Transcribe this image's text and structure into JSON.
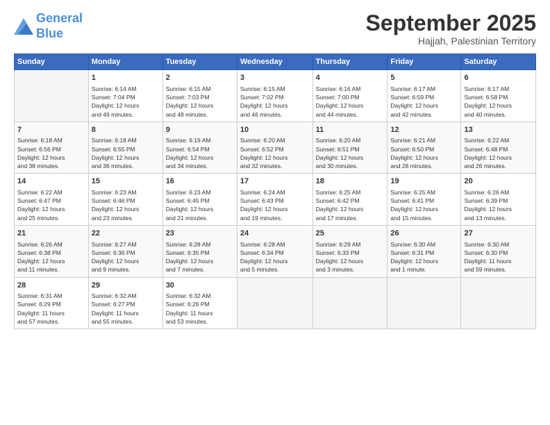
{
  "header": {
    "logo_line1": "General",
    "logo_line2": "Blue",
    "month": "September 2025",
    "location": "Hajjah, Palestinian Territory"
  },
  "days_of_week": [
    "Sunday",
    "Monday",
    "Tuesday",
    "Wednesday",
    "Thursday",
    "Friday",
    "Saturday"
  ],
  "weeks": [
    [
      {
        "day": "",
        "content": ""
      },
      {
        "day": "1",
        "content": "Sunrise: 6:14 AM\nSunset: 7:04 PM\nDaylight: 12 hours\nand 49 minutes."
      },
      {
        "day": "2",
        "content": "Sunrise: 6:15 AM\nSunset: 7:03 PM\nDaylight: 12 hours\nand 48 minutes."
      },
      {
        "day": "3",
        "content": "Sunrise: 6:15 AM\nSunset: 7:02 PM\nDaylight: 12 hours\nand 46 minutes."
      },
      {
        "day": "4",
        "content": "Sunrise: 6:16 AM\nSunset: 7:00 PM\nDaylight: 12 hours\nand 44 minutes."
      },
      {
        "day": "5",
        "content": "Sunrise: 6:17 AM\nSunset: 6:59 PM\nDaylight: 12 hours\nand 42 minutes."
      },
      {
        "day": "6",
        "content": "Sunrise: 6:17 AM\nSunset: 6:58 PM\nDaylight: 12 hours\nand 40 minutes."
      }
    ],
    [
      {
        "day": "7",
        "content": "Sunrise: 6:18 AM\nSunset: 6:56 PM\nDaylight: 12 hours\nand 38 minutes."
      },
      {
        "day": "8",
        "content": "Sunrise: 6:18 AM\nSunset: 6:55 PM\nDaylight: 12 hours\nand 36 minutes."
      },
      {
        "day": "9",
        "content": "Sunrise: 6:19 AM\nSunset: 6:54 PM\nDaylight: 12 hours\nand 34 minutes."
      },
      {
        "day": "10",
        "content": "Sunrise: 6:20 AM\nSunset: 6:52 PM\nDaylight: 12 hours\nand 32 minutes."
      },
      {
        "day": "11",
        "content": "Sunrise: 6:20 AM\nSunset: 6:51 PM\nDaylight: 12 hours\nand 30 minutes."
      },
      {
        "day": "12",
        "content": "Sunrise: 6:21 AM\nSunset: 6:50 PM\nDaylight: 12 hours\nand 28 minutes."
      },
      {
        "day": "13",
        "content": "Sunrise: 6:22 AM\nSunset: 6:48 PM\nDaylight: 12 hours\nand 26 minutes."
      }
    ],
    [
      {
        "day": "14",
        "content": "Sunrise: 6:22 AM\nSunset: 6:47 PM\nDaylight: 12 hours\nand 25 minutes."
      },
      {
        "day": "15",
        "content": "Sunrise: 6:23 AM\nSunset: 6:46 PM\nDaylight: 12 hours\nand 23 minutes."
      },
      {
        "day": "16",
        "content": "Sunrise: 6:23 AM\nSunset: 6:45 PM\nDaylight: 12 hours\nand 21 minutes."
      },
      {
        "day": "17",
        "content": "Sunrise: 6:24 AM\nSunset: 6:43 PM\nDaylight: 12 hours\nand 19 minutes."
      },
      {
        "day": "18",
        "content": "Sunrise: 6:25 AM\nSunset: 6:42 PM\nDaylight: 12 hours\nand 17 minutes."
      },
      {
        "day": "19",
        "content": "Sunrise: 6:25 AM\nSunset: 6:41 PM\nDaylight: 12 hours\nand 15 minutes."
      },
      {
        "day": "20",
        "content": "Sunrise: 6:26 AM\nSunset: 6:39 PM\nDaylight: 12 hours\nand 13 minutes."
      }
    ],
    [
      {
        "day": "21",
        "content": "Sunrise: 6:26 AM\nSunset: 6:38 PM\nDaylight: 12 hours\nand 11 minutes."
      },
      {
        "day": "22",
        "content": "Sunrise: 6:27 AM\nSunset: 6:36 PM\nDaylight: 12 hours\nand 9 minutes."
      },
      {
        "day": "23",
        "content": "Sunrise: 6:28 AM\nSunset: 6:35 PM\nDaylight: 12 hours\nand 7 minutes."
      },
      {
        "day": "24",
        "content": "Sunrise: 6:28 AM\nSunset: 6:34 PM\nDaylight: 12 hours\nand 5 minutes."
      },
      {
        "day": "25",
        "content": "Sunrise: 6:29 AM\nSunset: 6:33 PM\nDaylight: 12 hours\nand 3 minutes."
      },
      {
        "day": "26",
        "content": "Sunrise: 6:30 AM\nSunset: 6:31 PM\nDaylight: 12 hours\nand 1 minute."
      },
      {
        "day": "27",
        "content": "Sunrise: 6:30 AM\nSunset: 6:30 PM\nDaylight: 11 hours\nand 59 minutes."
      }
    ],
    [
      {
        "day": "28",
        "content": "Sunrise: 6:31 AM\nSunset: 6:29 PM\nDaylight: 11 hours\nand 57 minutes."
      },
      {
        "day": "29",
        "content": "Sunrise: 6:32 AM\nSunset: 6:27 PM\nDaylight: 11 hours\nand 55 minutes."
      },
      {
        "day": "30",
        "content": "Sunrise: 6:32 AM\nSunset: 6:26 PM\nDaylight: 11 hours\nand 53 minutes."
      },
      {
        "day": "",
        "content": ""
      },
      {
        "day": "",
        "content": ""
      },
      {
        "day": "",
        "content": ""
      },
      {
        "day": "",
        "content": ""
      }
    ]
  ]
}
